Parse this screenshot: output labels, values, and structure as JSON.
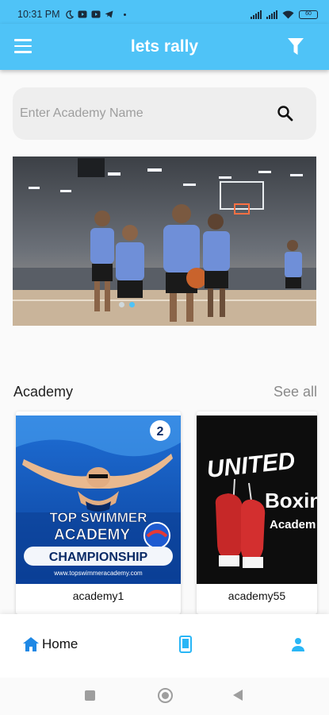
{
  "status_bar": {
    "time": "10:31 PM",
    "icons": [
      "moon-icon",
      "youtube-icon",
      "youtube-icon",
      "telegram-icon",
      "dot-icon"
    ],
    "battery": "60"
  },
  "app_bar": {
    "title": "lets rally",
    "menu_icon": "hamburger-menu-icon",
    "filter_icon": "filter-funnel-icon",
    "color": "#4fc3f7"
  },
  "search": {
    "placeholder": "Enter Academy Name",
    "value": ""
  },
  "banner": {
    "slides": 2,
    "active_slide": 1
  },
  "academy_section": {
    "title": "Academy",
    "see_all": "See all",
    "cards": [
      {
        "name": "academy1",
        "poster": {
          "badge": "2",
          "line1": "TOP SWIMMER",
          "line2": "ACADEMY",
          "line3": "CHAMPIONSHIP",
          "url": "www.topswimmeracademy.com"
        }
      },
      {
        "name": "academy55",
        "poster": {
          "line1": "UNITED",
          "line2": "Boxin",
          "line3": "Academ"
        }
      }
    ]
  },
  "bottom_nav": {
    "home_label": "Home",
    "home_icon": "home-icon",
    "middle_icon": "phone-device-icon",
    "profile_icon": "person-icon"
  },
  "system_nav": [
    "recents-square-icon",
    "home-circle-icon",
    "back-triangle-icon"
  ]
}
